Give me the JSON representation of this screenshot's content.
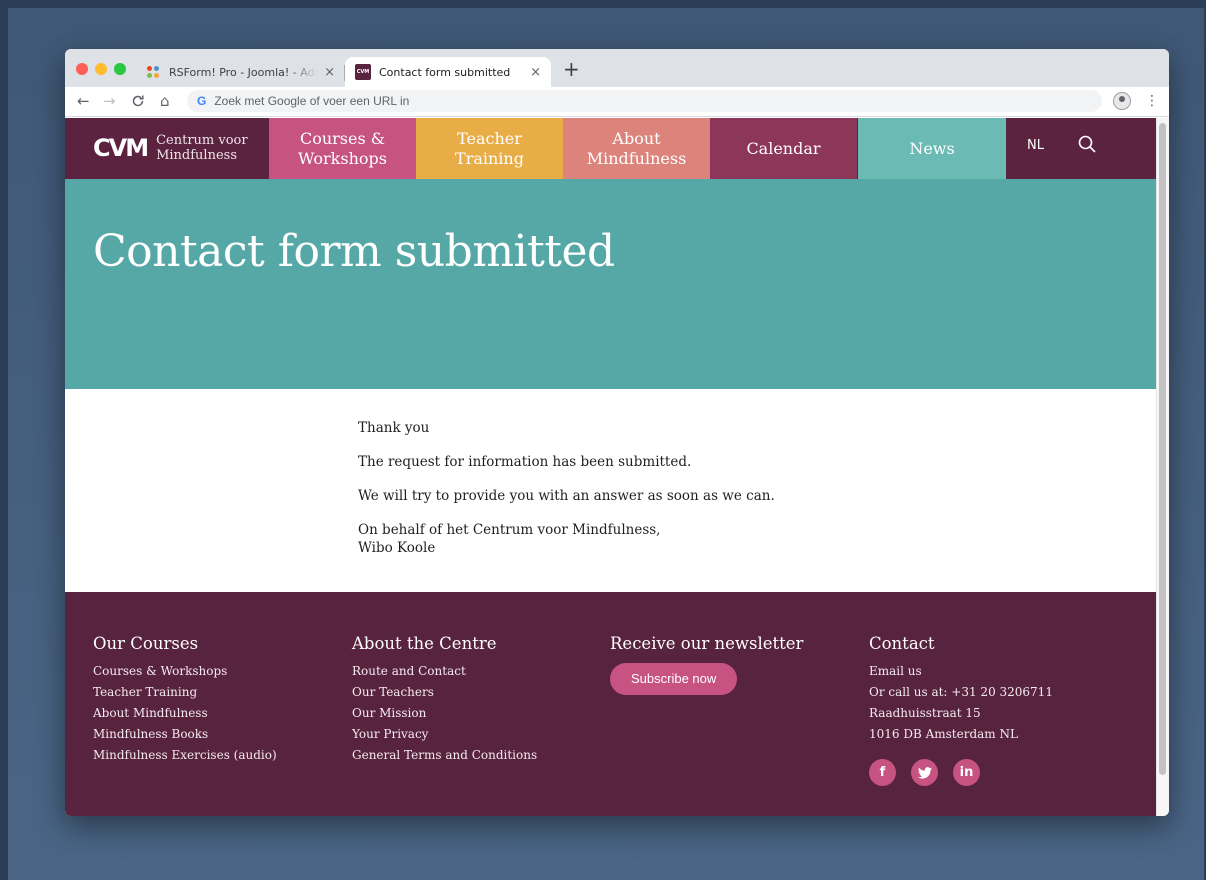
{
  "browser": {
    "tabs": [
      {
        "title": "RSForm! Pro - Joomla! - Administration",
        "close": "×"
      },
      {
        "title": "Contact form submitted",
        "close": "×"
      }
    ],
    "new_tab": "+",
    "omnibox_placeholder": "Zoek met Google of voer een URL in",
    "search_engine_glyph": "G",
    "icons": {
      "back": "←",
      "forward": "→",
      "reload": "C",
      "home": "⌂",
      "menu": "⋮"
    }
  },
  "site": {
    "logo_mark": "CVM",
    "logo_line1": "Centrum voor",
    "logo_line2": "Mindfulness",
    "nav": [
      {
        "line1": "Courses &",
        "line2": "Workshops",
        "color": "#c65381"
      },
      {
        "line1": "Teacher",
        "line2": "Training",
        "color": "#e8ad47"
      },
      {
        "line1": "About",
        "line2": "Mindfulness",
        "color": "#dc847c"
      },
      {
        "line1": "Calendar",
        "line2": "",
        "color": "#8c3659"
      },
      {
        "line1": "News",
        "line2": "",
        "color": "#6bbab4"
      }
    ],
    "lang": "NL"
  },
  "hero": {
    "title": "Contact form submitted",
    "color": "#56a8a7"
  },
  "content": {
    "p1": "Thank you",
    "p2": "The request for information has been submitted.",
    "p3": "We will try to provide you with an answer as soon as we can.",
    "p4_line1": "On behalf of het Centrum voor Mindfulness,",
    "p4_line2": "Wibo Koole"
  },
  "footer": {
    "color": "#57233e",
    "courses": {
      "title": "Our Courses",
      "links": [
        "Courses & Workshops",
        "Teacher Training",
        "About Mindfulness",
        "Mindfulness Books",
        "Mindfulness Exercises (audio)"
      ]
    },
    "about": {
      "title": "About the Centre",
      "links": [
        "Route and Contact",
        "Our Teachers",
        "Our Mission",
        "Your Privacy",
        "General Terms and Conditions"
      ]
    },
    "newsletter": {
      "title": "Receive our newsletter",
      "button": "Subscribe now"
    },
    "contact": {
      "title": "Contact",
      "lines": [
        "Email us",
        "Or call us at: +31 20 3206711",
        "Raadhuisstraat 15",
        "1016 DB Amsterdam NL"
      ],
      "socials": [
        {
          "glyph": "f",
          "icon": "facebook-icon"
        },
        {
          "glyph": "t",
          "icon": "twitter-icon"
        },
        {
          "glyph": "in",
          "icon": "linkedin-icon"
        }
      ]
    }
  }
}
